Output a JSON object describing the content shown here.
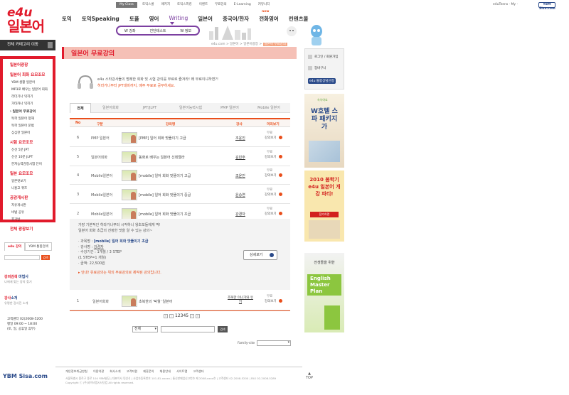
{
  "topbar": {
    "myclass": "My Class",
    "links": [
      "토익스쿨",
      "패키지",
      "토익스피킹",
      "이벤트",
      "무료강의",
      "E-Learning",
      "커뮤니티"
    ],
    "right": "e4uTeens · My ·",
    "ybm": "YBM Sisa.com"
  },
  "logo": {
    "brand": "e4u",
    "name": "일본어"
  },
  "gnb": {
    "items": [
      "토익",
      "토익Speaking",
      "토플",
      "영어",
      "Writing",
      "일본어",
      "중국어/한자",
      "전화영어",
      "컨텐츠몰"
    ],
    "new_badge": "new",
    "sub": [
      "W 강좌",
      "진단테스트",
      "W 정보"
    ]
  },
  "left": {
    "category_button": "전체 카테고리 이동",
    "box_title": "일본어광장",
    "menu": [
      {
        "t": "일본어 회화 요모조모",
        "type": "head"
      },
      {
        "t": "YBM 생활 일본어",
        "type": "sub"
      },
      {
        "t": "MP3로 배우는 일본어 회화",
        "type": "sub"
      },
      {
        "t": "리더기나 익히기",
        "type": "sub"
      },
      {
        "t": "가타카나 익히기",
        "type": "sub"
      },
      {
        "t": "› 일본어 무료강의",
        "type": "bold"
      },
      {
        "t": "독학 일본어 청해",
        "type": "sub"
      },
      {
        "t": "독학 일본어 문법",
        "type": "sub"
      },
      {
        "t": "심심한 일본어",
        "type": "sub"
      },
      {
        "t": "시험 요모조모",
        "type": "head"
      },
      {
        "t": "신선 5분 JPT",
        "type": "sub"
      },
      {
        "t": "신선 10분 JLPT",
        "type": "sub"
      },
      {
        "t": "한자능력검정시험 단어",
        "type": "sub"
      },
      {
        "t": "일본 요모조모",
        "type": "head"
      },
      {
        "t": "일본엿보기",
        "type": "sub"
      },
      {
        "t": "니홍고 퀴즈",
        "type": "sub"
      },
      {
        "t": "공감게시판",
        "type": "head"
      },
      {
        "t": "자유게시판",
        "type": "sub"
      },
      {
        "t": "비법 공유",
        "type": "sub"
      },
      {
        "t": "후기방",
        "type": "sub"
      },
      {
        "t": "전체 광장보기",
        "type": "head"
      }
    ],
    "tabs": [
      "e4u 강의",
      "YBM 통합검색"
    ],
    "search_go": "검색",
    "promo1": {
      "head_a": "강의검색",
      "head_b": " 마법사",
      "desc": "나에게 맞는 강의 찾기"
    },
    "promo2": {
      "head_a": "강사",
      "head_b": "소개",
      "desc": "유명한 강사진 소개"
    },
    "phone": [
      "고객센터 02)2008-5200",
      "평일 09:00 ~ 18:00",
      "(토, 일, 공휴일 휴무)"
    ]
  },
  "breadcrumb": {
    "path": "e4u.com > 일본어 > 일본어광장 >",
    "current": "일본어 무료강의"
  },
  "page_title": "일본어 무료강의",
  "intro": {
    "line1": "e4u 스타강사들의 명쾌한 회화 및 시험 강의를 무료로 즐겨라! 왜 무료이냐하면?!",
    "line2": "히라가나부터 JPT대비까지, 매주 무료로 공부하세요."
  },
  "tabs": [
    "전체",
    "일본어회화",
    "JPT/JLPT",
    "일본어능력시험",
    "PMP 일본어",
    "Mobile 일본어"
  ],
  "table": {
    "headers": [
      "No",
      "구분",
      "강의명",
      "강사",
      "미리보기"
    ],
    "rows": [
      {
        "no": "6",
        "cat": "PMP 일본어",
        "title": "[PMP] 일어 회화 맛뜰이기 고급",
        "teacher": "조윤진",
        "fee": "무료",
        "view": "강의보기"
      },
      {
        "no": "5",
        "cat": "일본어회화",
        "title": "동화로 배우는 일본어 신데렐라",
        "teacher": "김민주",
        "fee": "무료",
        "view": "강의보기"
      },
      {
        "no": "4",
        "cat": "Mobile일본어",
        "title": "[mobile] 일어 회화 맛뜰이기 고급",
        "teacher": "조윤진",
        "fee": "무료",
        "view": "강의보기"
      },
      {
        "no": "3",
        "cat": "Mobile일본어",
        "title": "[mobile] 일어 회화 맛뜰이기 중급",
        "teacher": "윤승연",
        "fee": "무료",
        "view": "강의보기"
      },
      {
        "no": "2",
        "cat": "Mobile일본어",
        "title": "[mobile] 일어 회화 맛뜰이기 초급",
        "teacher": "강경자",
        "fee": "무료",
        "view": "강의보기"
      }
    ],
    "last_row": {
      "no": "1",
      "cat": "일본어회화",
      "title": "초복한의 '탁월' 일본어",
      "teacher": "조복한 이나가와 유키",
      "fee": "무료",
      "view": "강의보기"
    }
  },
  "detail": {
    "desc1": "가장 기본적인 히라가나부터 시작하니 왕초보들에게 딱!",
    "desc2": "일본어 회화 초급의 진정한 맛을 알 수 있는 강의~",
    "course_label": "· 과목명 : ",
    "course": "[mobile] 일어 회화 맛뜰이기 초급",
    "teacher_label": "· 강사명 : ",
    "teacher": "강경자",
    "period": "· 수강기간 : 1개월 / 3 STEP",
    "steps": "(1 STEP=1 개월)",
    "price": "· 금액: 22,500원",
    "notice": "▸ 안내! 유료강의는 위의 무료강의로 제작된 강의입니다.",
    "button": "상세보기"
  },
  "paging": {
    "pages": "12345"
  },
  "search": {
    "select": "전체",
    "button": "검색"
  },
  "footer": {
    "family": "Family-site",
    "links": [
      "개인정보취급방침",
      "이용약관",
      "회사소개",
      "고객지원",
      "제휴문의",
      "채용안내",
      "사이트맵",
      "고객센터"
    ],
    "addr": "서울특별시 종로구 종로 104 YBM빌딩 | 대표이사 민선식 | 사업자등록번호 101-81-xxxxx | 통신판매업신고번호 제 2008-xxxx호 | 고객센터 02-2008-5200 | FAX 02-2008-5289",
    "copy": "Copyright ⓒ (주)와이비엠시사닷컴 All rights reserved.",
    "ybm": "YBM Sisa.com"
  },
  "right": {
    "menu": [
      "로그인 / 회원가입",
      "장바구니",
      "e4u 통합상담신청"
    ],
    "banners": [
      {
        "text": "W호텔 스파 패키지가",
        "sub": "속삭여요"
      },
      {
        "text": "2010 봄학기 e4u 일본어 개강 파티!",
        "sub": "참가하면"
      },
      {
        "text": "English Master Plan",
        "sub": "전생들을 위한"
      }
    ],
    "top": "TOP"
  }
}
